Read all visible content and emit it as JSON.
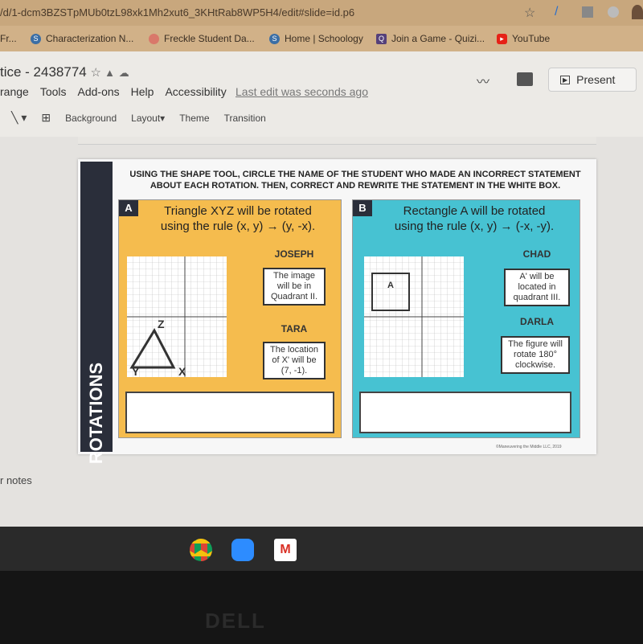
{
  "browser": {
    "url": "/d/1-dcm3BZSTpMUb0tzL98xk1Mh2xut6_3KHtRab8WP5H4/edit#slide=id.p6",
    "bookmarks": [
      {
        "label": "Fr...",
        "color": "#d1b188"
      },
      {
        "label": "Characterization N...",
        "color": "#3b6ea5"
      },
      {
        "label": "Freckle Student Da...",
        "color": "#d9786a"
      },
      {
        "label": "Home | Schoology",
        "color": "#3b6ea5"
      },
      {
        "label": "Join a Game - Quizi...",
        "color": "#55407a"
      },
      {
        "label": "YouTube",
        "color": "#e62117"
      }
    ]
  },
  "doc": {
    "title": "tice - 2438774",
    "menu": [
      "range",
      "Tools",
      "Add-ons",
      "Help",
      "Accessibility"
    ],
    "last_edit": "Last edit was seconds ago",
    "present": "Present"
  },
  "toolbar": {
    "background": "Background",
    "layout": "Layout",
    "theme": "Theme",
    "transition": "Transition"
  },
  "slide": {
    "side_title": "ROTATIONS",
    "instructions": "USING THE SHAPE TOOL, CIRCLE THE NAME OF THE STUDENT WHO MADE AN INCORRECT STATEMENT ABOUT EACH ROTATION. THEN, CORRECT AND REWRITE THE STATEMENT IN THE WHITE BOX.",
    "a": {
      "label": "A",
      "heading1": "Triangle XYZ will be rotated",
      "heading2": "using the rule (x, y) → (y, -x).",
      "s1_name": "JOSEPH",
      "s1_text": "The image will be in Quadrant II.",
      "s2_name": "TARA",
      "s2_text": "The location of X' will be (7, -1).",
      "vertices": {
        "z": "Z",
        "y": "Y",
        "x": "X"
      },
      "color": "#f5bc4e"
    },
    "b": {
      "label": "B",
      "heading1": "Rectangle A will be rotated",
      "heading2": "using the rule (x, y) → (-x, -y).",
      "s1_name": "CHAD",
      "s1_text": "A' will be located in quadrant III.",
      "s2_name": "DARLA",
      "s2_text": "The figure will rotate 180° clockwise.",
      "shape_label": "A",
      "color": "#47c2d2"
    },
    "copyright": "©Maneuvering the Middle LLC, 2019"
  },
  "notes": "r notes",
  "monitor_brand": "DELL"
}
